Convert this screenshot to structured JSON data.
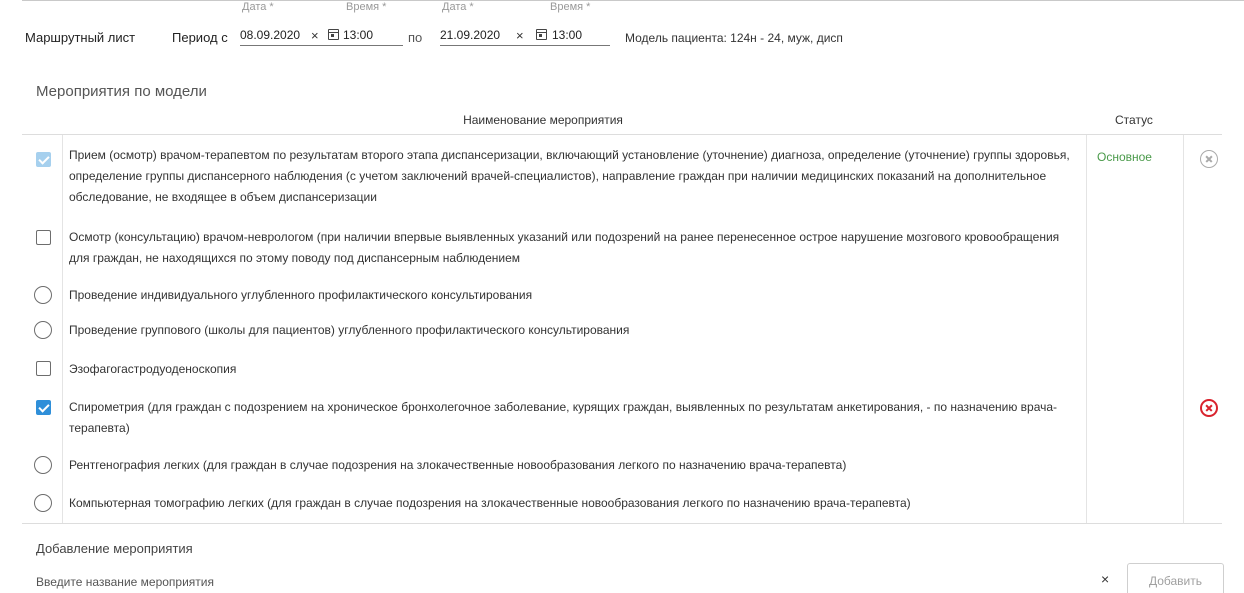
{
  "header": {
    "title": "Маршрутный лист",
    "period_label": "Период с",
    "to_label": "по",
    "start": {
      "date_label": "Дата *",
      "date_value": "08.09.2020",
      "time_label": "Время *",
      "time_value": "13:00"
    },
    "end": {
      "date_label": "Дата *",
      "date_value": "21.09.2020",
      "time_label": "Время *",
      "time_value": "13:00"
    },
    "clear_glyph": "×",
    "model_info": "Модель пациента: 124н - 24, муж, дисп"
  },
  "section": {
    "title": "Мероприятия по модели",
    "col_name": "Наименование мероприятия",
    "col_status": "Статус"
  },
  "activities": [
    {
      "text": "Прием (осмотр) врачом-терапевтом по результатам второго этапа диспансеризации, включающий установление (уточнение) диагноза, определение (уточнение) группы здоровья, определение группы диспансерного наблюдения (с учетом заключений врачей-специалистов), направление граждан при наличии медицинских показаний на дополнительное обследование, не входящее в объем диспансеризации",
      "status": "Основное",
      "control": "checkbox",
      "checked": true,
      "disabled": true,
      "delete": "inactive"
    },
    {
      "text": "Осмотр (консультацию) врачом-неврологом (при наличии впервые выявленных указаний или подозрений на ранее перенесенное острое нарушение мозгового кровообращения для граждан, не находящихся по этому поводу под диспансерным наблюдением",
      "status": "",
      "control": "checkbox",
      "checked": false
    },
    {
      "text": "Проведение индивидуального углубленного профилактического консультирования",
      "status": "",
      "control": "radio",
      "checked": false
    },
    {
      "text": "Проведение группового (школы для пациентов) углубленного профилактического консультирования",
      "status": "",
      "control": "radio",
      "checked": false
    },
    {
      "text": "Эзофагогастродуоденоскопия",
      "status": "",
      "control": "checkbox",
      "checked": false
    },
    {
      "text": "Спирометрия (для граждан с подозрением на хроническое бронхолегочное заболевание, курящих граждан, выявленных по результатам анкетирования, - по назначению врача-терапевта)",
      "status": "",
      "control": "checkbox",
      "checked": true,
      "delete": "active"
    },
    {
      "text": "Рентгенография легких (для граждан в случае подозрения на злокачественные новообразования легкого по назначению врача-терапевта)",
      "status": "",
      "control": "radio",
      "checked": false
    },
    {
      "text": "Компьютерная томографию легких (для граждан в случае подозрения на злокачественные новообразования легкого по назначению врача-терапевта)",
      "status": "",
      "control": "radio",
      "checked": false
    }
  ],
  "add": {
    "title": "Добавление мероприятия",
    "placeholder": "Введите название мероприятия",
    "clear_glyph": "×",
    "button_label": "Добавить"
  },
  "colors": {
    "status_green": "#4a9a4a",
    "checkbox_blue": "#2f8fd9",
    "delete_red": "#d9232d"
  }
}
